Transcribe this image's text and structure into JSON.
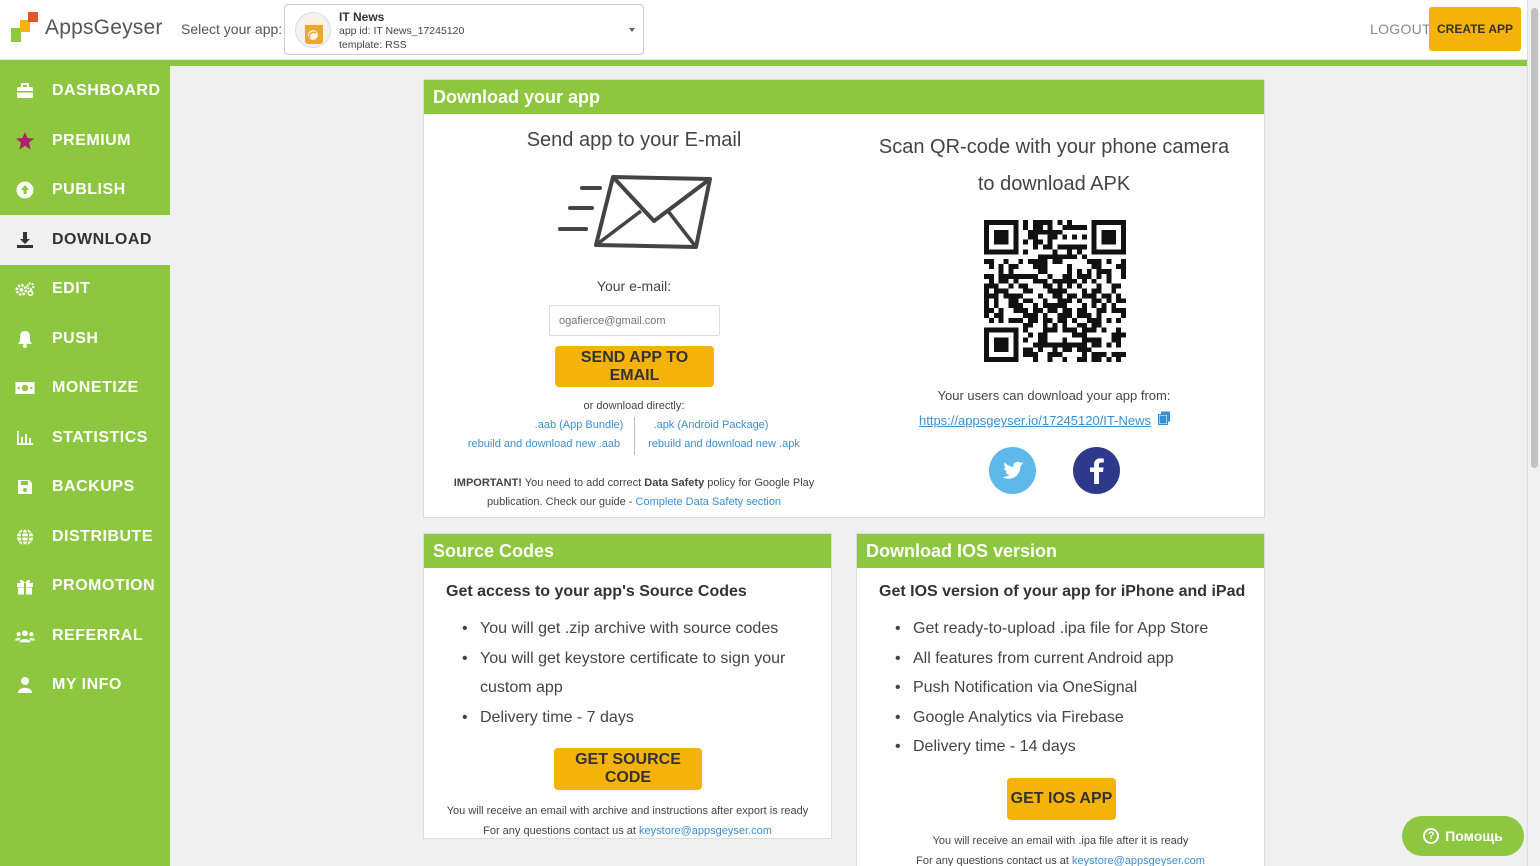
{
  "header": {
    "logo_text": "AppsGeyser",
    "select_label": "Select your app:",
    "app": {
      "name": "IT News",
      "id_text": "app id: IT News_17245120",
      "template_text": "template: RSS"
    },
    "logout_label": "LOGOUT",
    "create_app_label": "CREATE APP"
  },
  "sidebar": {
    "items": [
      {
        "label": "DASHBOARD",
        "icon": "briefcase-icon"
      },
      {
        "label": "PREMIUM",
        "icon": "star-icon"
      },
      {
        "label": "PUBLISH",
        "icon": "upload-icon"
      },
      {
        "label": "DOWNLOAD",
        "icon": "download-icon",
        "active": true
      },
      {
        "label": "EDIT",
        "icon": "gears-icon"
      },
      {
        "label": "PUSH",
        "icon": "bell-icon"
      },
      {
        "label": "MONETIZE",
        "icon": "money-icon"
      },
      {
        "label": "STATISTICS",
        "icon": "chart-icon"
      },
      {
        "label": "BACKUPS",
        "icon": "save-icon"
      },
      {
        "label": "DISTRIBUTE",
        "icon": "globe-icon"
      },
      {
        "label": "PROMOTION",
        "icon": "gift-icon"
      },
      {
        "label": "REFERRAL",
        "icon": "users-icon"
      },
      {
        "label": "MY INFO",
        "icon": "user-icon"
      }
    ]
  },
  "download": {
    "title": "Download your app",
    "email_title": "Send app to your E-mail",
    "email_label": "Your e-mail:",
    "email_placeholder": "ogafierce@gmail.com",
    "send_button": "SEND APP TO EMAIL",
    "or_direct": "or download directly:",
    "aab_link": ".aab (App Bundle)",
    "apk_link": ".apk (Android Package)",
    "rebuild_aab": "rebuild and download new .aab",
    "rebuild_apk": "rebuild and download new .apk",
    "important_bold": "IMPORTANT!",
    "important_text": " You need to add correct ",
    "data_safety_bold": "Data Safety",
    "important_text2": " policy for Google Play",
    "important_line2": "publication. Check our guide - ",
    "guide_link": "Complete Data Safety section",
    "qr_title_1": "Scan QR-code with your phone camera",
    "qr_title_2": "to download APK",
    "users_download": "Your users can download your app from:",
    "app_url": "https://appsgeyser.io/17245120/IT-News"
  },
  "source": {
    "title": "Source Codes",
    "subtitle": "Get access to your app's Source Codes",
    "bullets": [
      "You will get .zip archive with source codes",
      "You will get keystore certificate to sign your custom app",
      "Delivery time - 7 days"
    ],
    "button": "GET SOURCE CODE",
    "note": "You will receive an email with archive and instructions after export is ready",
    "contact_prefix": "For any questions contact us at ",
    "contact_email": "keystore@appsgeyser.com"
  },
  "ios": {
    "title": "Download IOS version",
    "subtitle": "Get IOS version of your app for iPhone and iPad",
    "bullets": [
      "Get ready-to-upload .ipa file for App Store",
      "All features from current Android app",
      "Push Notification via OneSignal",
      "Google Analytics via Firebase",
      "Delivery time - 14 days"
    ],
    "button": "GET IOS APP",
    "note": "You will receive an email with .ipa file after it is ready",
    "contact_prefix": "For any questions contact us at ",
    "contact_email": "keystore@appsgeyser.com"
  },
  "help_label": "Помощь",
  "colors": {
    "green": "#8dc63f",
    "yellow": "#f5b30a",
    "link": "#3a8fd0",
    "twitter": "#5eb8ea",
    "facebook": "#2d3a8c"
  }
}
